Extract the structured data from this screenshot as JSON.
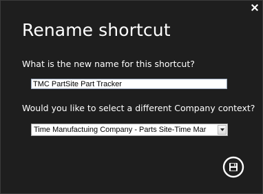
{
  "dialog": {
    "title": "Rename shortcut",
    "name_prompt": "What is the new name for this shortcut?",
    "name_value": "TMC PartSite Part Tracker",
    "company_prompt": "Would you like to select a different Company context?",
    "company_selected": "Time Manufactuing Company - Parts Site-Time Mar"
  },
  "icons": {
    "close": "close-icon",
    "dropdown": "chevron-down-icon",
    "save": "save-icon"
  },
  "colors": {
    "background": "#1e1e1e",
    "text": "#ffffff"
  }
}
